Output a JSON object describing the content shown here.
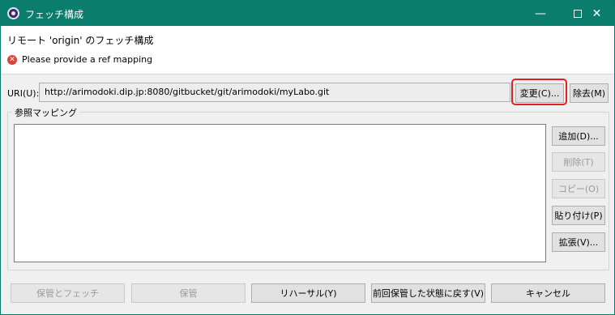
{
  "window": {
    "title": "フェッチ構成",
    "controls": {
      "minimize": "—",
      "close": "✕"
    }
  },
  "header": {
    "title": "リモート 'origin' のフェッチ構成",
    "error_message": "Please provide a ref mapping",
    "error_glyph": "✕"
  },
  "uri": {
    "label": "URI(U):",
    "value": "http://arimodoki.dip.jp:8080/gitbucket/git/arimodoki/myLabo.git",
    "change_button": "変更(C)...",
    "remove_button": "除去(M)"
  },
  "ref_mapping": {
    "group_label": "参照マッピング",
    "buttons": {
      "add": "追加(D)...",
      "delete": "削除(T)",
      "copy": "コピー(O)",
      "paste": "貼り付け(P)",
      "expand": "拡張(V)..."
    }
  },
  "footer": {
    "save_and_fetch": "保管とフェッチ",
    "save": "保管",
    "rehearsal": "リハーサル(Y)",
    "revert": "前回保管した状態に戻す(V)",
    "cancel": "キャンセル"
  },
  "colors": {
    "titlebar": "#0a7d6d",
    "highlight": "#e02020",
    "error_icon": "#d9443b"
  }
}
